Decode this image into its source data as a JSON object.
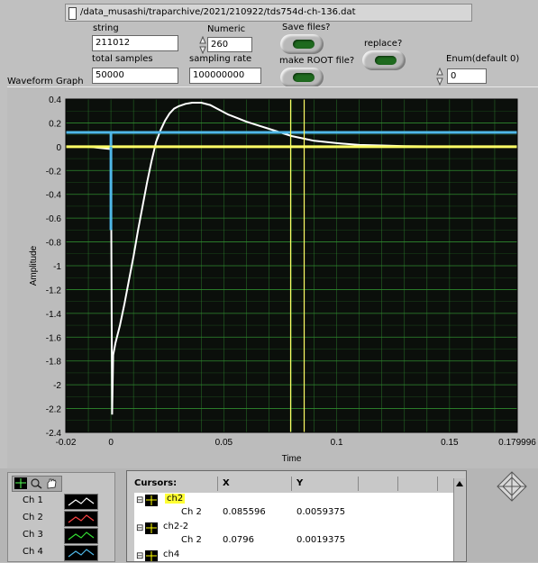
{
  "file_path": "/data_musashi/traparchive/2021/210922/tds754d-ch-136.dat",
  "controls": {
    "string_label": "string",
    "string_value": "211012",
    "numeric_label": "Numeric",
    "numeric_value": "260",
    "save_files_label": "Save files?",
    "replace_label": "replace?",
    "total_samples_label": "total samples",
    "total_samples_value": "50000",
    "sampling_rate_label": "sampling rate",
    "sampling_rate_value": "100000000",
    "make_root_label": "make ROOT file?",
    "enum_label": "Enum(default 0)",
    "enum_value": "0"
  },
  "graph_title": "Waveform Graph",
  "chart_data": {
    "type": "line",
    "xlabel": "Time",
    "ylabel": "Amplitude",
    "xlim": [
      -0.02,
      0.179996
    ],
    "ylim": [
      -2.4,
      0.4
    ],
    "x_tick_labels": [
      "-0.02",
      "0",
      "0.05",
      "0.1",
      "0.15",
      "0.179996"
    ],
    "x_ticks": [
      -0.02,
      0,
      0.05,
      0.1,
      0.15,
      0.179996
    ],
    "y_ticks": [
      "0.4",
      "0.2",
      "0",
      "-0.2",
      "-0.4",
      "-0.6",
      "-0.8",
      "-1",
      "-1.2",
      "-1.4",
      "-1.6",
      "-1.8",
      "-2",
      "-2.2",
      "-2.4"
    ],
    "grid": true,
    "background": "#0b0f0b",
    "grid_color": "#2f8a2f",
    "series": [
      {
        "name": "Ch 1",
        "color": "#ffffff",
        "x": [
          -0.02,
          -0.01,
          0,
          0.0005,
          0.001,
          0.002,
          0.004,
          0.006,
          0.008,
          0.01,
          0.012,
          0.014,
          0.016,
          0.018,
          0.02,
          0.022,
          0.024,
          0.026,
          0.028,
          0.03,
          0.033,
          0.036,
          0.04,
          0.044,
          0.048,
          0.052,
          0.056,
          0.06,
          0.065,
          0.07,
          0.075,
          0.08,
          0.085,
          0.09,
          0.1,
          0.11,
          0.12,
          0.13,
          0.14,
          0.15,
          0.16,
          0.17,
          0.179996
        ],
        "y": [
          0.0,
          0.0,
          -0.02,
          -2.25,
          -1.75,
          -1.65,
          -1.5,
          -1.32,
          -1.12,
          -0.92,
          -0.7,
          -0.5,
          -0.3,
          -0.12,
          0.04,
          0.14,
          0.22,
          0.28,
          0.32,
          0.34,
          0.36,
          0.37,
          0.37,
          0.35,
          0.31,
          0.27,
          0.24,
          0.21,
          0.18,
          0.15,
          0.12,
          0.09,
          0.07,
          0.05,
          0.03,
          0.015,
          0.01,
          0.005,
          0.003,
          0.002,
          0.002,
          0.001,
          0.0
        ]
      },
      {
        "name": "Ch 2",
        "color": "#ffff66",
        "x": [
          -0.02,
          0.179996
        ],
        "y": [
          0.0,
          0.0
        ]
      },
      {
        "name": "Ch 4",
        "color": "#4fb8e8",
        "x": [
          -0.02,
          0,
          0,
          0,
          0.179996
        ],
        "y": [
          0.12,
          0.12,
          -0.7,
          0.12,
          0.12
        ]
      }
    ],
    "cursors": [
      {
        "name": "ch2",
        "x": 0.085596,
        "y": 0.0059375,
        "color": "#ffff66"
      },
      {
        "name": "ch2-2",
        "x": 0.0796,
        "y": 0.0019375,
        "color": "#ffff66"
      }
    ]
  },
  "plot_legend": [
    {
      "name": "Ch 1",
      "color": "#ffffff"
    },
    {
      "name": "Ch 2",
      "color": "#ff4444"
    },
    {
      "name": "Ch 3",
      "color": "#33dd33"
    },
    {
      "name": "Ch 4",
      "color": "#4fb8e8"
    }
  ],
  "cursor_table": {
    "headers": [
      "Cursors:",
      "X",
      "Y"
    ],
    "rows": [
      {
        "cursor": "ch2",
        "plot": "Ch 2",
        "x": "0.085596",
        "y": "0.0059375"
      },
      {
        "cursor": "ch2-2",
        "plot": "Ch 2",
        "x": "0.0796",
        "y": "0.0019375"
      },
      {
        "cursor": "ch4",
        "plot": "",
        "x": "",
        "y": ""
      }
    ]
  }
}
